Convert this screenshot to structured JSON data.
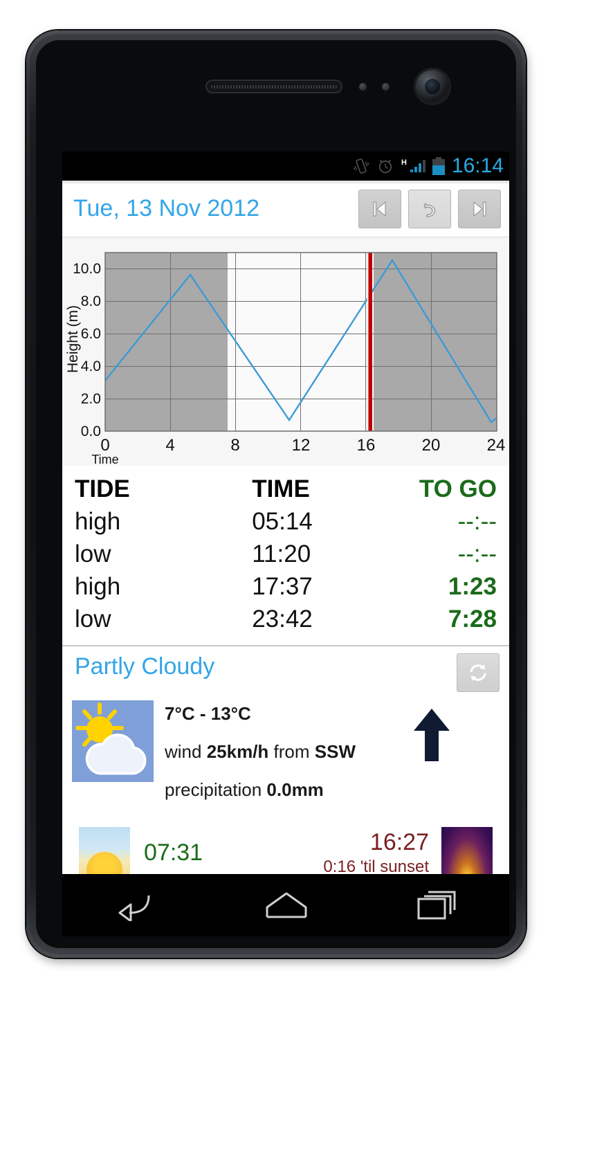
{
  "status_bar": {
    "clock": "16:14",
    "icons": [
      "vibrate-icon",
      "alarm-icon",
      "hspa-signal-icon",
      "battery-icon"
    ],
    "clock_color": "#2aabe2"
  },
  "title_bar": {
    "date": "Tue, 13 Nov 2012",
    "buttons": [
      {
        "name": "previous-day-button",
        "icon": "skip-previous-icon"
      },
      {
        "name": "today-reset-button",
        "icon": "undo-arrow-icon"
      },
      {
        "name": "next-day-button",
        "icon": "skip-next-icon"
      }
    ],
    "title_color": "#33a5e8"
  },
  "chart_data": {
    "type": "area",
    "title": "",
    "xlabel": "Time",
    "ylabel": "Height (m)",
    "xlim": [
      0,
      24
    ],
    "ylim": [
      0.0,
      11.0
    ],
    "xticks": [
      0,
      4,
      8,
      12,
      16,
      20,
      24
    ],
    "yticks": [
      "0.0",
      "2.0",
      "4.0",
      "6.0",
      "8.0",
      "10.0"
    ],
    "grid": true,
    "series": [
      {
        "name": "Tide height",
        "x": [
          0,
          5.23,
          11.33,
          17.62,
          23.7,
          24
        ],
        "y": [
          3.1,
          9.6,
          0.7,
          9.95,
          0.55,
          0.8
        ]
      }
    ],
    "night_shading": [
      [
        0,
        7.52
      ],
      [
        16.45,
        24
      ]
    ],
    "now_marker": {
      "x": 16.23,
      "color": "#c00000",
      "label": "16:14"
    },
    "series_color": "#3b9bd4",
    "shade_color": "#9e9e9e"
  },
  "tide_table": {
    "headers": {
      "tide": "TIDE",
      "time": "TIME",
      "togo": "TO GO"
    },
    "rows": [
      {
        "tide": "high",
        "time": "05:14",
        "togo": "--:--",
        "past": true
      },
      {
        "tide": "low",
        "time": "11:20",
        "togo": "--:--",
        "past": true
      },
      {
        "tide": "high",
        "time": "17:37",
        "togo": "1:23",
        "past": false
      },
      {
        "tide": "low",
        "time": "23:42",
        "togo": "7:28",
        "past": false
      }
    ],
    "togo_color": "#1a6b1a"
  },
  "weather": {
    "condition": "Partly Cloudy",
    "refresh_button": {
      "name": "refresh-button",
      "icon": "refresh-sync-icon"
    },
    "icon_name": "partly-cloudy-icon",
    "temperature": "7°C - 13°C",
    "wind_prefix": "wind ",
    "wind_speed": "25km/h",
    "wind_mid": " from ",
    "wind_direction": "SSW",
    "wind_arrow_name": "wind-direction-arrow",
    "precip_prefix": "precipitation ",
    "precip_value": "0.0mm",
    "condition_color": "#33a5e8"
  },
  "sun": {
    "sunrise_icon": "sunrise-icon",
    "sunrise_time": "07:31",
    "sunset_time": "16:27",
    "sunset_note": "0:16 'til sunset",
    "sunset_icon": "sunset-icon",
    "sunrise_color": "#1a6b1a",
    "sunset_color": "#7a1f20"
  },
  "nav_bar": {
    "keys": [
      {
        "name": "back-key",
        "icon": "back-arrow-icon"
      },
      {
        "name": "home-key",
        "icon": "home-icon"
      },
      {
        "name": "recents-key",
        "icon": "recent-apps-icon"
      }
    ]
  }
}
